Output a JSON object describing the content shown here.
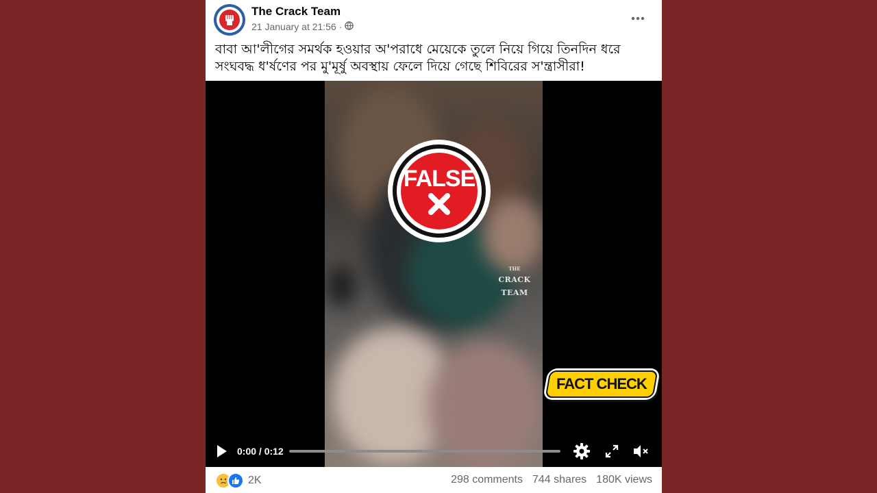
{
  "post": {
    "page_name": "The Crack Team",
    "timestamp": "21 January at 21:56",
    "separator": "·",
    "audience_icon": "globe-icon",
    "caption": "বাবা আ'লীগের সমর্থক হওয়ার অ'পরাধে মেয়েকে তুলে নিয়ে গিয়ে তিনদিন ধরে সংঘবদ্ধ ধ'র্ষণের পর মু'মূর্ষু অবস্থায় ফেলে দিয়ে গেছে শিবিরের স'ন্ত্রাসীরা!"
  },
  "video": {
    "watermark_small": "THE",
    "watermark_big": "CRACK TEAM",
    "false_label": "FALSE",
    "fact_check_label": "FACT CHECK",
    "time": "0:00 / 0:12",
    "progress": 0
  },
  "footer": {
    "reaction_count": "2K",
    "comments": "298 comments",
    "shares": "744 shares",
    "views": "180K views"
  },
  "colors": {
    "background": "#7a2526",
    "false_red": "#e31b23",
    "fact_check_yellow": "#ffd000"
  }
}
